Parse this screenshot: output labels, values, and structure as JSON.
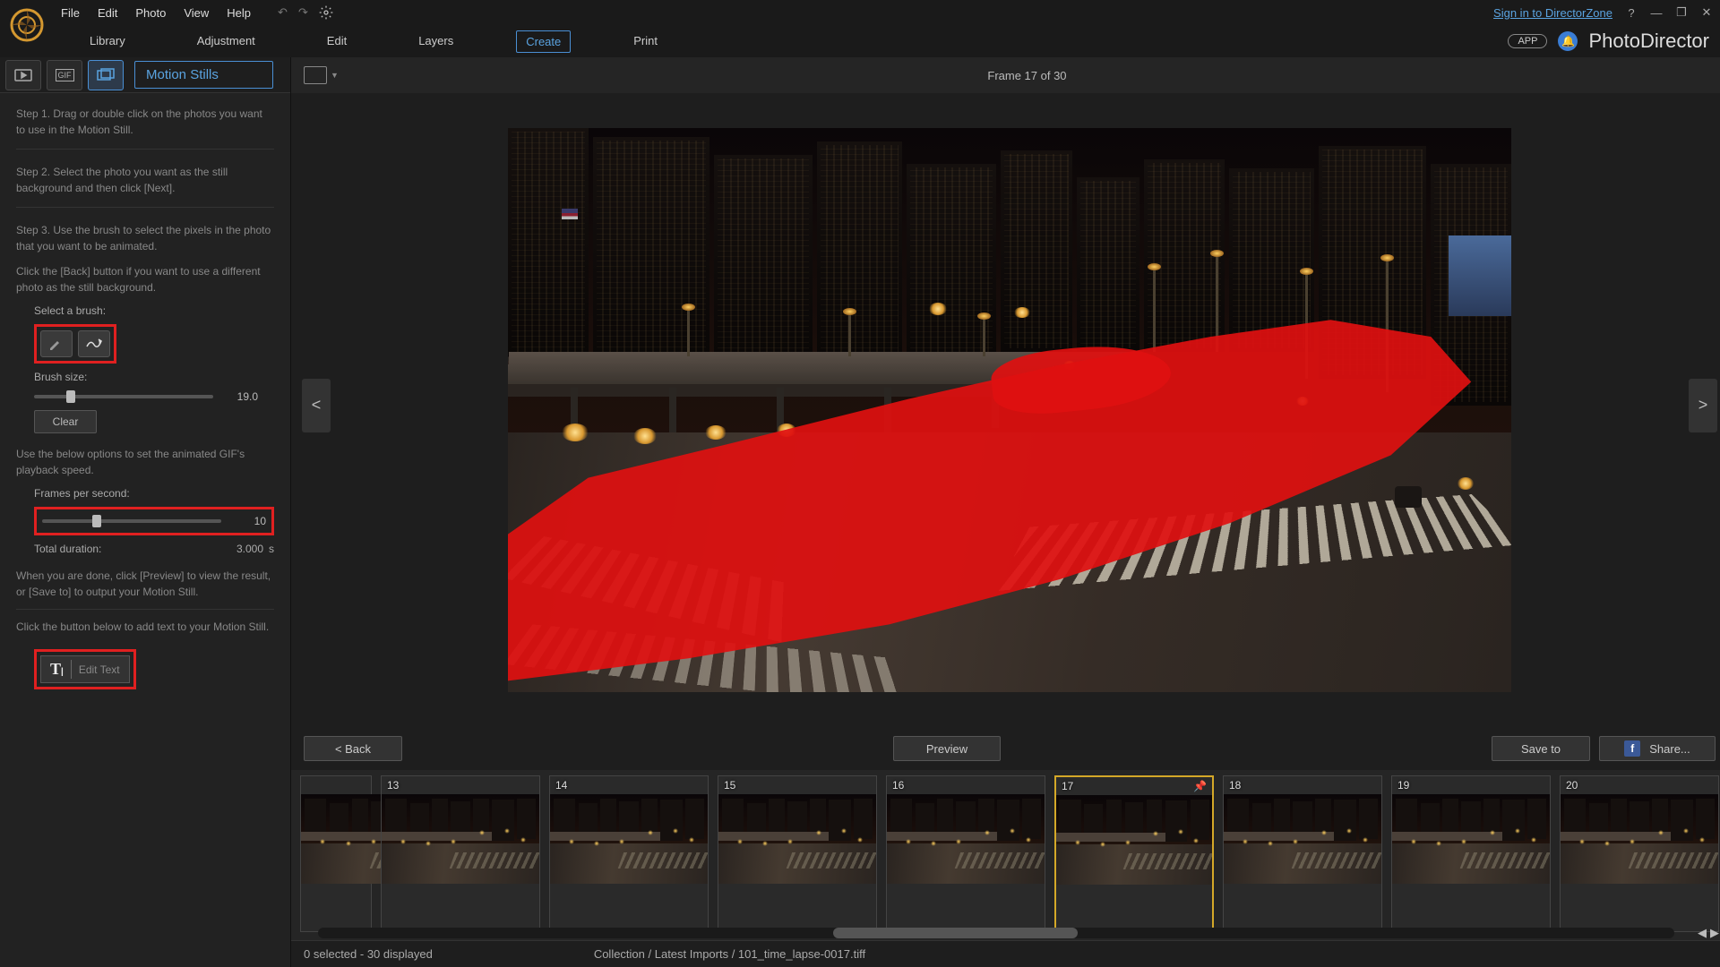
{
  "menu": {
    "file": "File",
    "edit": "Edit",
    "photo": "Photo",
    "view": "View",
    "help": "Help"
  },
  "signin": "Sign in to DirectorZone",
  "app_btn": "APP",
  "app_name": "PhotoDirector",
  "tabs": {
    "library": "Library",
    "adjustment": "Adjustment",
    "edit": "Edit",
    "layers": "Layers",
    "create": "Create",
    "print": "Print"
  },
  "panel": {
    "title": "Motion Stills",
    "step1": "Step 1. Drag or double click on the photos you want to use in the Motion Still.",
    "step2": "Step 2. Select the photo you want as the still background and then click [Next].",
    "step3": "Step 3. Use the brush to select the pixels in the photo that you want to be animated.",
    "step3b": "Click the [Back] button if you want to use a different photo as the still background.",
    "select_brush": "Select a brush:",
    "brush_size": "Brush size:",
    "brush_size_val": "19.0",
    "clear": "Clear",
    "gif_help": "Use the below options to set the animated GIF's playback speed.",
    "fps_label": "Frames per second:",
    "fps_val": "10",
    "duration_label": "Total duration:",
    "duration_val": "3.000",
    "duration_unit": "s",
    "done_help": "When you are done, click [Preview] to view the result, or [Save to] to output your Motion Still.",
    "text_help": "Click the button below to add text to your Motion Still.",
    "edit_text": "Edit Text"
  },
  "frame_counter": "Frame  17 of  30",
  "buttons": {
    "back": "<   Back",
    "preview": "Preview",
    "save": "Save to",
    "share": "Share..."
  },
  "thumbs": [
    "13",
    "14",
    "15",
    "16",
    "17",
    "18",
    "19",
    "20"
  ],
  "selected_thumb": "17",
  "status": {
    "selection": "0 selected - 30 displayed",
    "path": "Collection / Latest Imports / 101_time_lapse-0017.tiff"
  }
}
